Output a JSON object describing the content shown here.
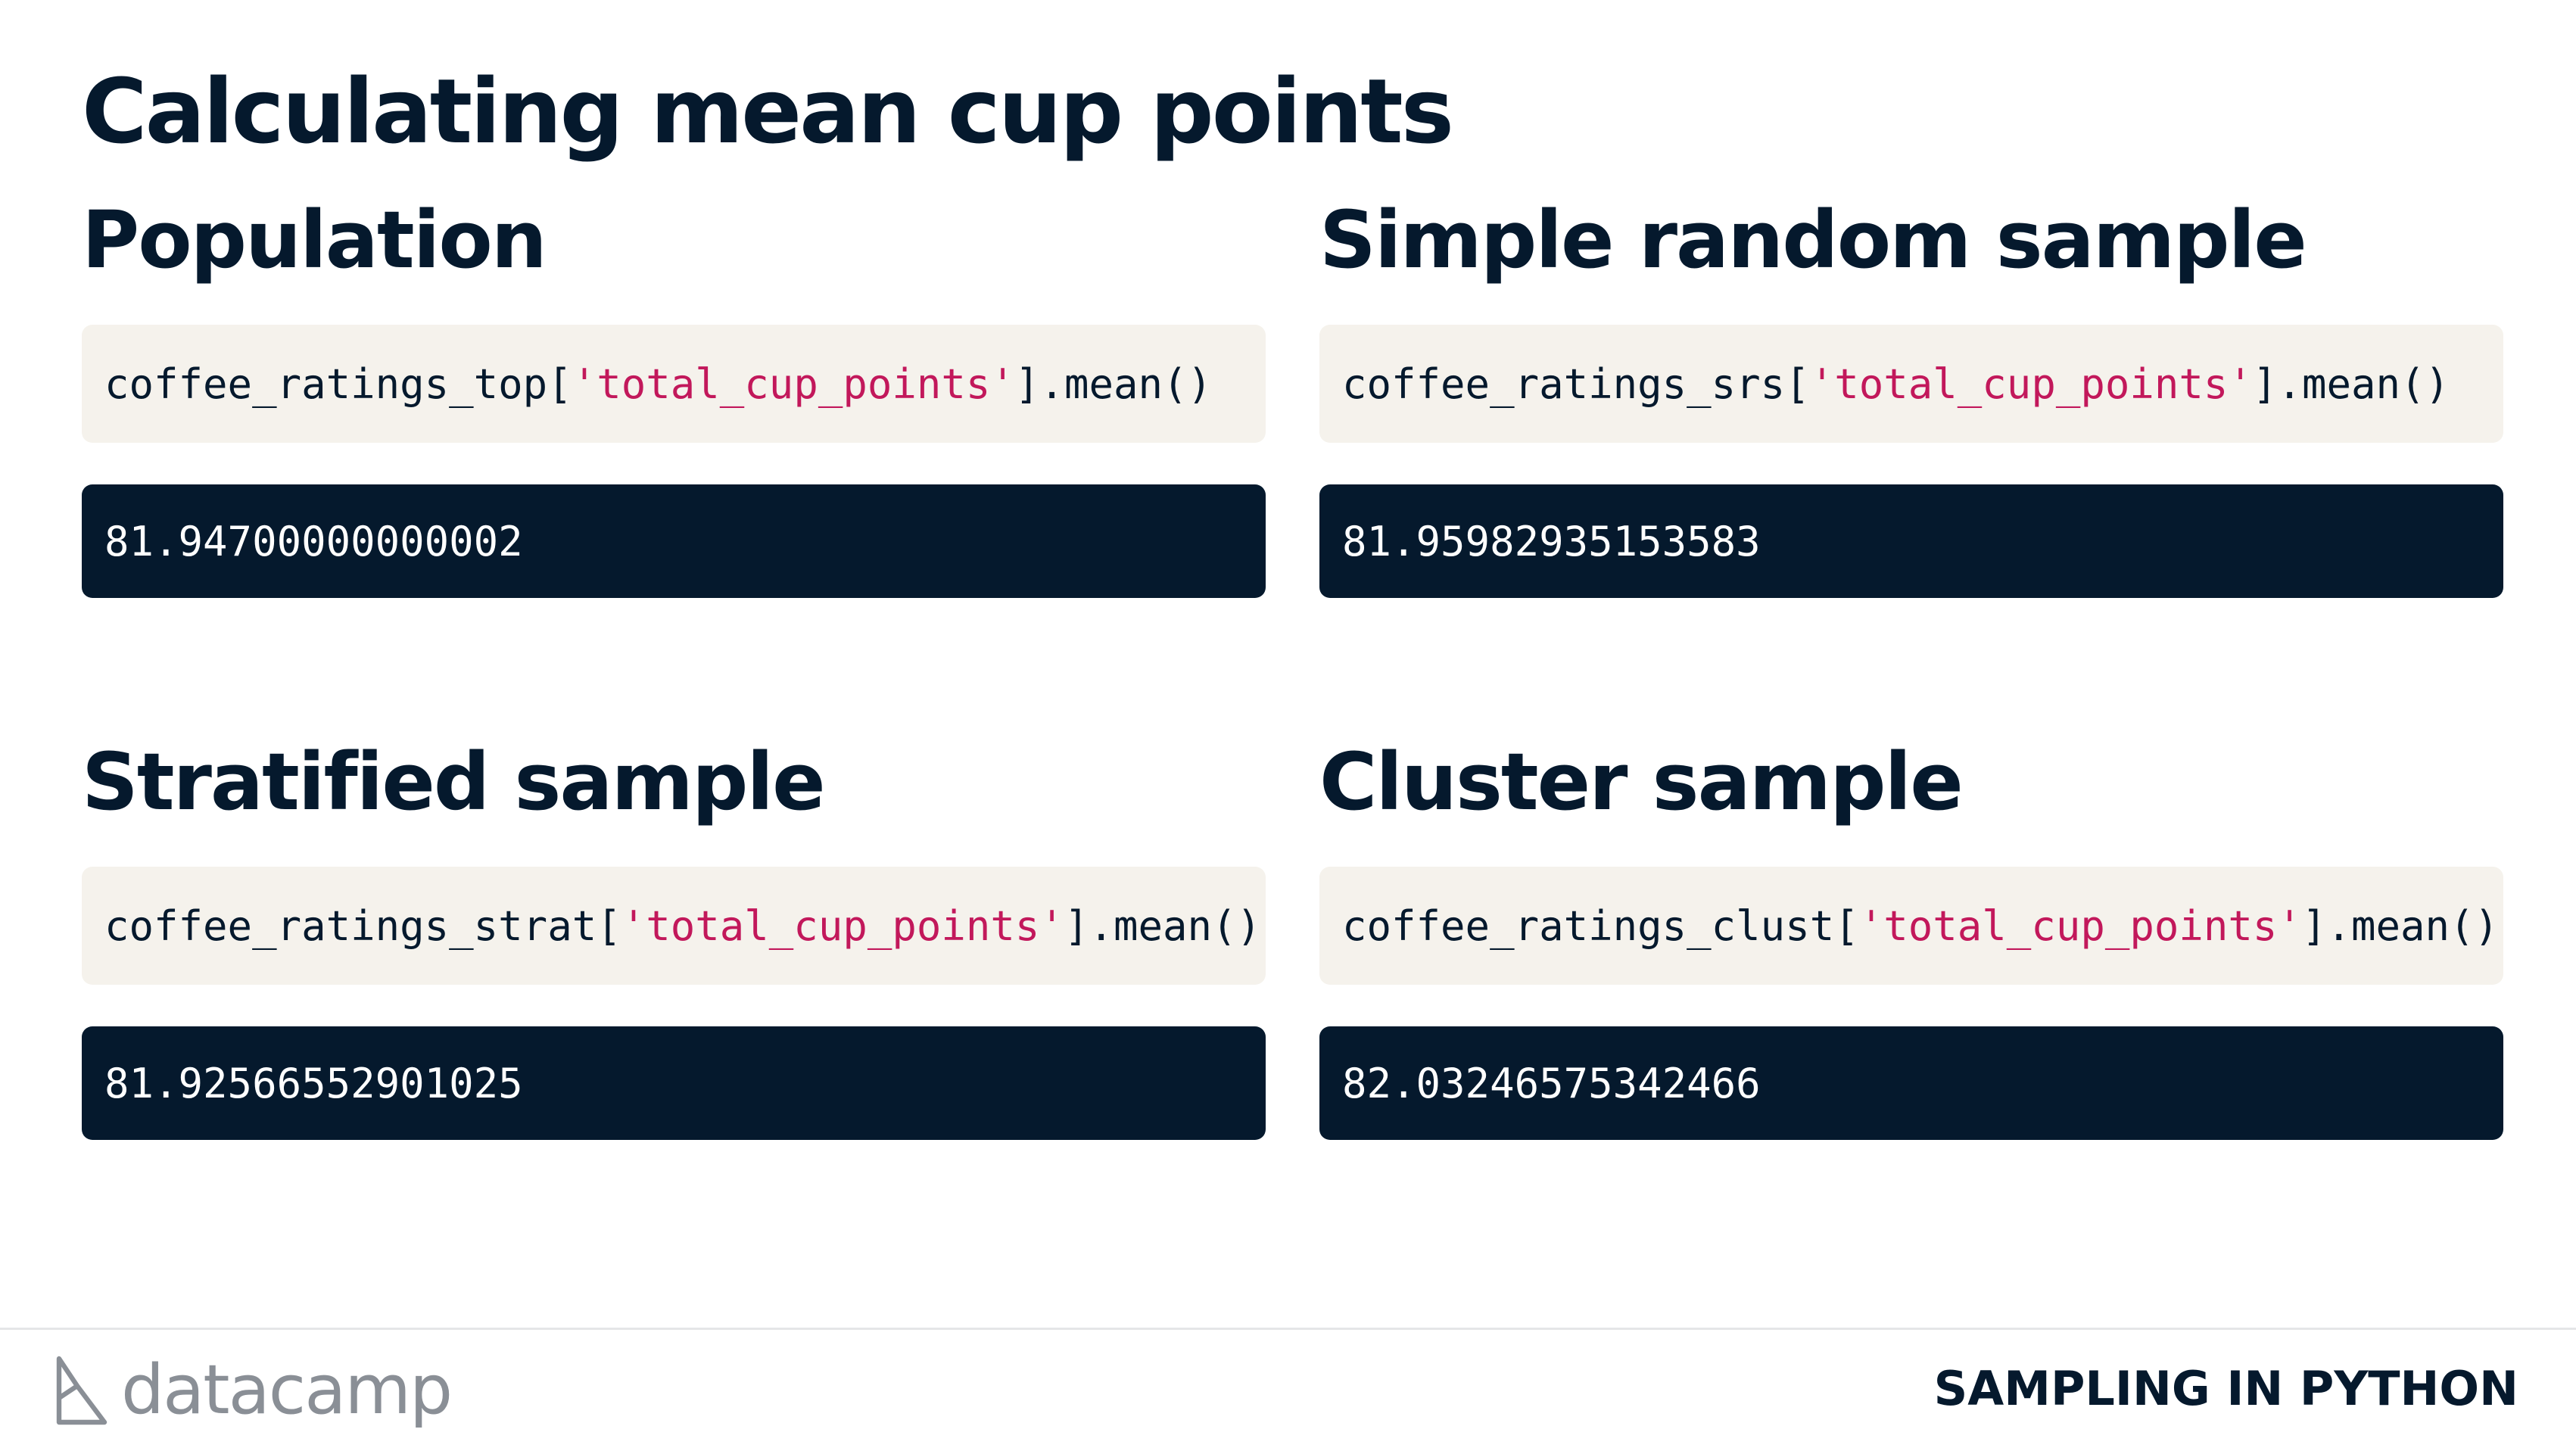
{
  "slide": {
    "title": "Calculating mean cup points"
  },
  "sections": [
    {
      "heading": "Population",
      "code_prefix": "coffee_ratings_top[",
      "code_string": "'total_cup_points'",
      "code_suffix": "].mean()",
      "output": "81.94700000000002"
    },
    {
      "heading": "Simple random sample",
      "code_prefix": "coffee_ratings_srs[",
      "code_string": "'total_cup_points'",
      "code_suffix": "].mean()",
      "output": "81.95982935153583"
    },
    {
      "heading": "Stratified sample",
      "code_prefix": "coffee_ratings_strat[",
      "code_string": "'total_cup_points'",
      "code_suffix": "].mean()",
      "output": "81.92566552901025"
    },
    {
      "heading": "Cluster sample",
      "code_prefix": "coffee_ratings_clust[",
      "code_string": "'total_cup_points'",
      "code_suffix": "].mean()",
      "output": "82.03246575342466"
    }
  ],
  "footer": {
    "logo_text": "datacamp",
    "logo_icon": "datacamp-logo-icon",
    "course_name": "SAMPLING IN PYTHON"
  },
  "colors": {
    "text": "#05192d",
    "code_background": "#f5f2ec",
    "output_background": "#05192d",
    "string_literal": "#c2185b",
    "logo": "#8a8f96"
  }
}
